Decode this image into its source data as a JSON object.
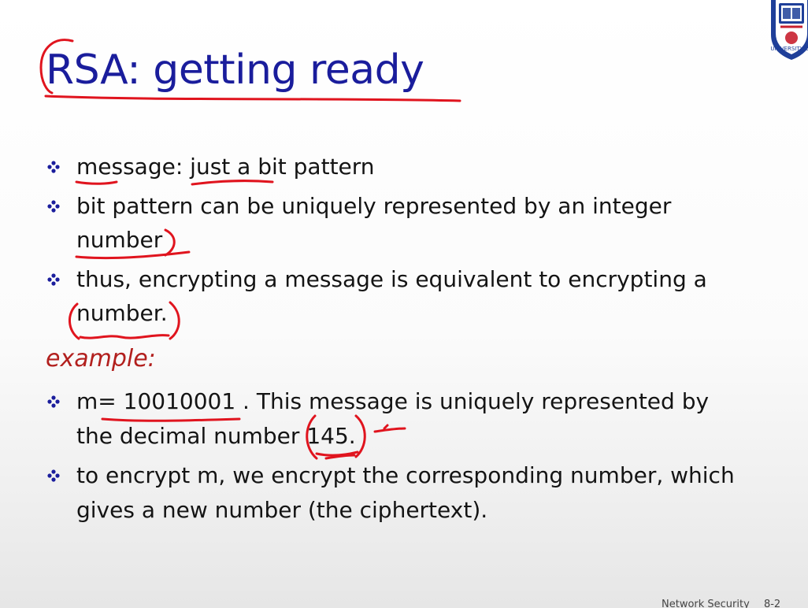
{
  "slide": {
    "title": "RSA: getting ready",
    "bullets": [
      "message: just a bit pattern",
      "bit pattern can be uniquely represented by an integer number",
      "thus, encrypting a message is equivalent to encrypting a number."
    ],
    "example_label": "example:",
    "example_bullets": [
      "m= 10010001 . This message is uniquely represented by the decimal number 145.",
      "to encrypt m, we encrypt the corresponding number, which gives a new number (the ciphertext)."
    ]
  },
  "footer": {
    "course": "Network Security",
    "page": "8-2"
  },
  "logo": {
    "text": "UNIVERSITY OF",
    "primary_color": "#1f3f99",
    "accent_color": "#c8202f"
  },
  "colors": {
    "title": "#1a1d9c",
    "bullet_text": "#141414",
    "bullet_marker": "#1a1d9c",
    "example_label": "#b2201e",
    "annotation_ink": "#e0141e"
  }
}
